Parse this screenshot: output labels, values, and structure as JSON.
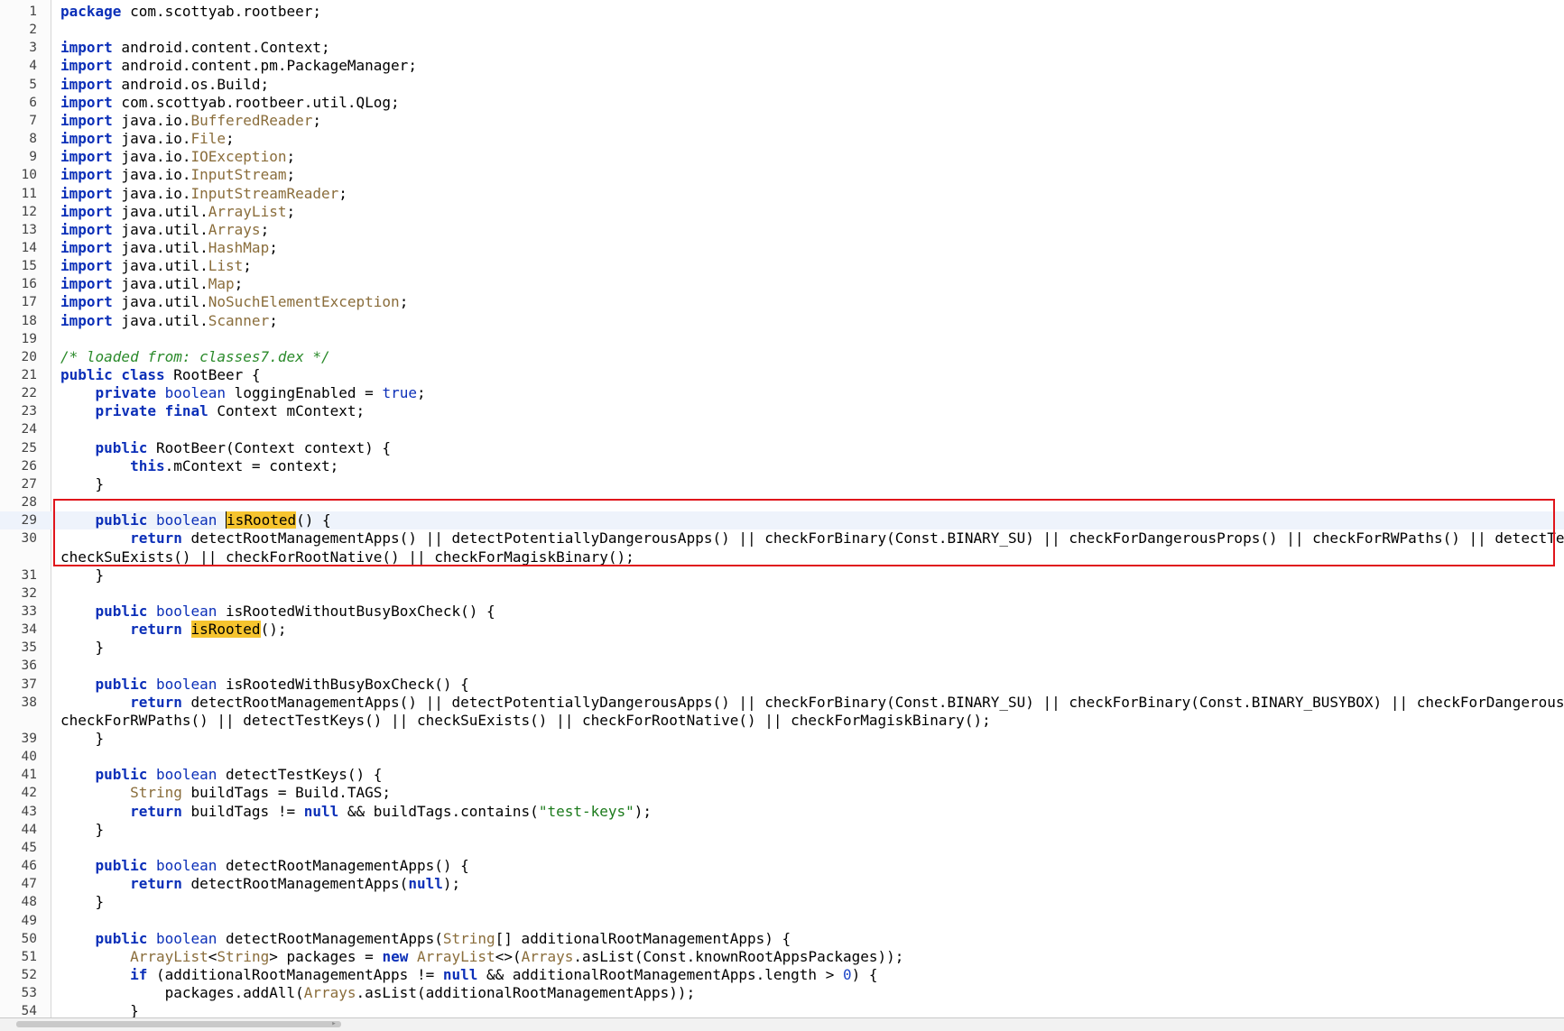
{
  "editor": {
    "language": "java",
    "highlighted_symbol": "isRooted",
    "colors": {
      "keyword": "#0b2fb8",
      "type": "#8a6d3b",
      "comment": "#2a8a2a",
      "string": "#1b7a1b",
      "match_highlight": "#f6c42e",
      "annotation_box": "#e0151b"
    },
    "lines": [
      {
        "n": "1",
        "tokens": [
          [
            "k",
            "package"
          ],
          [
            "p",
            " com.scottyab.rootbeer;"
          ]
        ]
      },
      {
        "n": "2",
        "tokens": []
      },
      {
        "n": "3",
        "tokens": [
          [
            "k",
            "import"
          ],
          [
            "p",
            " android.content.Context;"
          ]
        ]
      },
      {
        "n": "4",
        "tokens": [
          [
            "k",
            "import"
          ],
          [
            "p",
            " android.content.pm.PackageManager;"
          ]
        ]
      },
      {
        "n": "5",
        "tokens": [
          [
            "k",
            "import"
          ],
          [
            "p",
            " android.os.Build;"
          ]
        ]
      },
      {
        "n": "6",
        "tokens": [
          [
            "k",
            "import"
          ],
          [
            "p",
            " com.scottyab.rootbeer.util.QLog;"
          ]
        ]
      },
      {
        "n": "7",
        "tokens": [
          [
            "k",
            "import"
          ],
          [
            "p",
            " java.io."
          ],
          [
            "ty",
            "BufferedReader"
          ],
          [
            "p",
            ";"
          ]
        ]
      },
      {
        "n": "8",
        "tokens": [
          [
            "k",
            "import"
          ],
          [
            "p",
            " java.io."
          ],
          [
            "ty",
            "File"
          ],
          [
            "p",
            ";"
          ]
        ]
      },
      {
        "n": "9",
        "tokens": [
          [
            "k",
            "import"
          ],
          [
            "p",
            " java.io."
          ],
          [
            "ty",
            "IOException"
          ],
          [
            "p",
            ";"
          ]
        ]
      },
      {
        "n": "10",
        "tokens": [
          [
            "k",
            "import"
          ],
          [
            "p",
            " java.io."
          ],
          [
            "ty",
            "InputStream"
          ],
          [
            "p",
            ";"
          ]
        ]
      },
      {
        "n": "11",
        "tokens": [
          [
            "k",
            "import"
          ],
          [
            "p",
            " java.io."
          ],
          [
            "ty",
            "InputStreamReader"
          ],
          [
            "p",
            ";"
          ]
        ]
      },
      {
        "n": "12",
        "tokens": [
          [
            "k",
            "import"
          ],
          [
            "p",
            " java.util."
          ],
          [
            "ty",
            "ArrayList"
          ],
          [
            "p",
            ";"
          ]
        ]
      },
      {
        "n": "13",
        "tokens": [
          [
            "k",
            "import"
          ],
          [
            "p",
            " java.util."
          ],
          [
            "ty",
            "Arrays"
          ],
          [
            "p",
            ";"
          ]
        ]
      },
      {
        "n": "14",
        "tokens": [
          [
            "k",
            "import"
          ],
          [
            "p",
            " java.util."
          ],
          [
            "ty",
            "HashMap"
          ],
          [
            "p",
            ";"
          ]
        ]
      },
      {
        "n": "15",
        "tokens": [
          [
            "k",
            "import"
          ],
          [
            "p",
            " java.util."
          ],
          [
            "ty",
            "List"
          ],
          [
            "p",
            ";"
          ]
        ]
      },
      {
        "n": "16",
        "tokens": [
          [
            "k",
            "import"
          ],
          [
            "p",
            " java.util."
          ],
          [
            "ty",
            "Map"
          ],
          [
            "p",
            ";"
          ]
        ]
      },
      {
        "n": "17",
        "tokens": [
          [
            "k",
            "import"
          ],
          [
            "p",
            " java.util."
          ],
          [
            "ty",
            "NoSuchElementException"
          ],
          [
            "p",
            ";"
          ]
        ]
      },
      {
        "n": "18",
        "tokens": [
          [
            "k",
            "import"
          ],
          [
            "p",
            " java.util."
          ],
          [
            "ty",
            "Scanner"
          ],
          [
            "p",
            ";"
          ]
        ]
      },
      {
        "n": "19",
        "tokens": []
      },
      {
        "n": "20",
        "tokens": [
          [
            "c",
            "/* loaded from: classes7.dex */"
          ]
        ]
      },
      {
        "n": "21",
        "tokens": [
          [
            "k",
            "public class"
          ],
          [
            "p",
            " RootBeer {"
          ]
        ]
      },
      {
        "n": "22",
        "tokens": [
          [
            "p",
            "    "
          ],
          [
            "k",
            "private"
          ],
          [
            "p",
            " "
          ],
          [
            "t",
            "boolean"
          ],
          [
            "p",
            " loggingEnabled = "
          ],
          [
            "t",
            "true"
          ],
          [
            "p",
            ";"
          ]
        ]
      },
      {
        "n": "23",
        "tokens": [
          [
            "p",
            "    "
          ],
          [
            "k",
            "private final"
          ],
          [
            "p",
            " Context mContext;"
          ]
        ]
      },
      {
        "n": "24",
        "tokens": []
      },
      {
        "n": "25",
        "tokens": [
          [
            "p",
            "    "
          ],
          [
            "k",
            "public"
          ],
          [
            "p",
            " RootBeer(Context context) {"
          ]
        ]
      },
      {
        "n": "26",
        "tokens": [
          [
            "p",
            "        "
          ],
          [
            "k",
            "this"
          ],
          [
            "p",
            ".mContext = context;"
          ]
        ]
      },
      {
        "n": "27",
        "tokens": [
          [
            "p",
            "    }"
          ]
        ]
      },
      {
        "n": "28",
        "tokens": []
      },
      {
        "n": "29",
        "current": true,
        "tokens": [
          [
            "p",
            "    "
          ],
          [
            "k",
            "public"
          ],
          [
            "p",
            " "
          ],
          [
            "t",
            "boolean"
          ],
          [
            "p",
            " "
          ],
          [
            "hlc",
            "isRooted"
          ],
          [
            "p",
            "() {"
          ]
        ]
      },
      {
        "n": "30",
        "tokens": [
          [
            "p",
            "        "
          ],
          [
            "k",
            "return"
          ],
          [
            "p",
            " detectRootManagementApps() || detectPotentiallyDangerousApps() || checkForBinary(Const.BINARY_SU) || checkForDangerousProps() || checkForRWPaths() || detectTestKeys() ||"
          ]
        ]
      },
      {
        "n": "",
        "tokens": [
          [
            "p",
            "checkSuExists() || checkForRootNative() || checkForMagiskBinary();"
          ]
        ]
      },
      {
        "n": "31",
        "tokens": [
          [
            "p",
            "    }"
          ]
        ]
      },
      {
        "n": "32",
        "tokens": []
      },
      {
        "n": "33",
        "tokens": [
          [
            "p",
            "    "
          ],
          [
            "k",
            "public"
          ],
          [
            "p",
            " "
          ],
          [
            "t",
            "boolean"
          ],
          [
            "p",
            " isRootedWithoutBusyBoxCheck() {"
          ]
        ]
      },
      {
        "n": "34",
        "tokens": [
          [
            "p",
            "        "
          ],
          [
            "k",
            "return"
          ],
          [
            "p",
            " "
          ],
          [
            "hl",
            "isRooted"
          ],
          [
            "p",
            "();"
          ]
        ]
      },
      {
        "n": "35",
        "tokens": [
          [
            "p",
            "    }"
          ]
        ]
      },
      {
        "n": "36",
        "tokens": []
      },
      {
        "n": "37",
        "tokens": [
          [
            "p",
            "    "
          ],
          [
            "k",
            "public"
          ],
          [
            "p",
            " "
          ],
          [
            "t",
            "boolean"
          ],
          [
            "p",
            " isRootedWithBusyBoxCheck() {"
          ]
        ]
      },
      {
        "n": "38",
        "tokens": [
          [
            "p",
            "        "
          ],
          [
            "k",
            "return"
          ],
          [
            "p",
            " detectRootManagementApps() || detectPotentiallyDangerousApps() || checkForBinary(Const.BINARY_SU) || checkForBinary(Const.BINARY_BUSYBOX) || checkForDangerousProps() ||"
          ]
        ]
      },
      {
        "n": "",
        "tokens": [
          [
            "p",
            "checkForRWPaths() || detectTestKeys() || checkSuExists() || checkForRootNative() || checkForMagiskBinary();"
          ]
        ]
      },
      {
        "n": "39",
        "tokens": [
          [
            "p",
            "    }"
          ]
        ]
      },
      {
        "n": "40",
        "tokens": []
      },
      {
        "n": "41",
        "tokens": [
          [
            "p",
            "    "
          ],
          [
            "k",
            "public"
          ],
          [
            "p",
            " "
          ],
          [
            "t",
            "boolean"
          ],
          [
            "p",
            " detectTestKeys() {"
          ]
        ]
      },
      {
        "n": "42",
        "tokens": [
          [
            "p",
            "        "
          ],
          [
            "ty",
            "String"
          ],
          [
            "p",
            " buildTags = Build.TAGS;"
          ]
        ]
      },
      {
        "n": "43",
        "tokens": [
          [
            "p",
            "        "
          ],
          [
            "k",
            "return"
          ],
          [
            "p",
            " buildTags != "
          ],
          [
            "k",
            "null"
          ],
          [
            "p",
            " && buildTags.contains("
          ],
          [
            "s",
            "\"test-keys\""
          ],
          [
            "p",
            ");"
          ]
        ]
      },
      {
        "n": "44",
        "tokens": [
          [
            "p",
            "    }"
          ]
        ]
      },
      {
        "n": "45",
        "tokens": []
      },
      {
        "n": "46",
        "tokens": [
          [
            "p",
            "    "
          ],
          [
            "k",
            "public"
          ],
          [
            "p",
            " "
          ],
          [
            "t",
            "boolean"
          ],
          [
            "p",
            " detectRootManagementApps() {"
          ]
        ]
      },
      {
        "n": "47",
        "tokens": [
          [
            "p",
            "        "
          ],
          [
            "k",
            "return"
          ],
          [
            "p",
            " detectRootManagementApps("
          ],
          [
            "k",
            "null"
          ],
          [
            "p",
            ");"
          ]
        ]
      },
      {
        "n": "48",
        "tokens": [
          [
            "p",
            "    }"
          ]
        ]
      },
      {
        "n": "49",
        "tokens": []
      },
      {
        "n": "50",
        "tokens": [
          [
            "p",
            "    "
          ],
          [
            "k",
            "public"
          ],
          [
            "p",
            " "
          ],
          [
            "t",
            "boolean"
          ],
          [
            "p",
            " detectRootManagementApps("
          ],
          [
            "ty",
            "String"
          ],
          [
            "p",
            "[] additionalRootManagementApps) {"
          ]
        ]
      },
      {
        "n": "51",
        "tokens": [
          [
            "p",
            "        "
          ],
          [
            "ty",
            "ArrayList"
          ],
          [
            "p",
            "<"
          ],
          [
            "ty",
            "String"
          ],
          [
            "p",
            "> packages = "
          ],
          [
            "k",
            "new"
          ],
          [
            "p",
            " "
          ],
          [
            "ty",
            "ArrayList"
          ],
          [
            "p",
            "<>("
          ],
          [
            "ty",
            "Arrays"
          ],
          [
            "p",
            ".asList(Const.knownRootAppsPackages));"
          ]
        ]
      },
      {
        "n": "52",
        "tokens": [
          [
            "p",
            "        "
          ],
          [
            "k",
            "if"
          ],
          [
            "p",
            " (additionalRootManagementApps != "
          ],
          [
            "k",
            "null"
          ],
          [
            "p",
            " && additionalRootManagementApps.length > "
          ],
          [
            "n",
            "0"
          ],
          [
            "p",
            ") {"
          ]
        ]
      },
      {
        "n": "53",
        "tokens": [
          [
            "p",
            "            packages.addAll("
          ],
          [
            "ty",
            "Arrays"
          ],
          [
            "p",
            ".asList(additionalRootManagementApps));"
          ]
        ]
      },
      {
        "n": "54",
        "tokens": [
          [
            "p",
            "        }"
          ]
        ]
      }
    ]
  }
}
